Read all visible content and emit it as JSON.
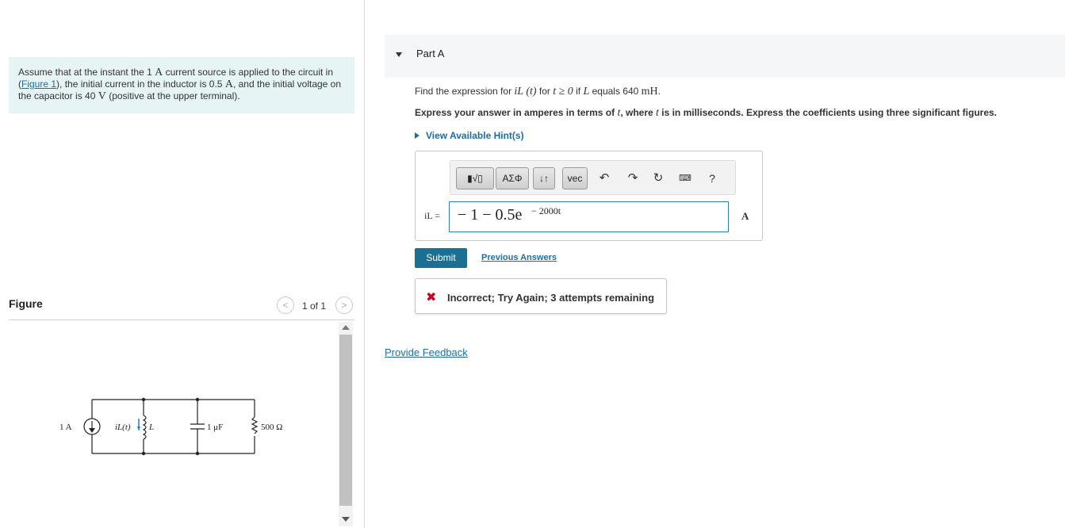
{
  "problem": {
    "text_before_math": "Assume that at the instant the 1 ",
    "current_unit": "A",
    "text_after_unit": " current source is applied to the circuit in ",
    "figure_link": "Figure 1",
    "text_mid": "), the initial current in the inductor is 0.5 ",
    "current_unit_2": "A",
    "text_mid2": ", and the initial voltage on the capacitor is 40 ",
    "voltage_unit": "V",
    "text_end": " (positive at the upper terminal)."
  },
  "figure_panel": {
    "title": "Figure",
    "count": "1 of 1",
    "prev_icon": "chevron-left-icon",
    "next_icon": "chevron-right-icon"
  },
  "circuit": {
    "source_label": "1 A",
    "inductor_current_label": "iL(t)",
    "inductor_label": "L",
    "capacitor_label": "1 μF",
    "resistor_label": "500 Ω"
  },
  "part": {
    "title": "Part A"
  },
  "question": {
    "prefix": "Find the expression for ",
    "var": "iL (t)",
    "mid": " for ",
    "condition": "t ≥ 0",
    "mid2": " if ",
    "L_var": "L",
    "mid3": " equals 640 ",
    "unit": "mH",
    "suffix": "."
  },
  "instruction": {
    "a": "Express your answer in amperes in terms of ",
    "t1": "t",
    "b": ", where ",
    "t2": "t",
    "c": " is in milliseconds. Express the coefficients using three significant figures."
  },
  "hints_link": "View Available Hint(s)",
  "toolbar": {
    "template_btn": "▮√▯",
    "greek_btn": "ΑΣΦ",
    "arrows_btn": "↓↑",
    "vec_btn": "vec",
    "undo_icon": "undo-icon",
    "redo_icon": "redo-icon",
    "reset_icon": "reset-icon",
    "keyboard_icon": "keyboard-icon",
    "help_label": "?"
  },
  "answer": {
    "lhs": "iL =",
    "expression": "− 1 − 0.5e",
    "exponent": "− 2000t",
    "unit": "A"
  },
  "submit_label": "Submit",
  "previous_answers_label": "Previous Answers",
  "feedback": {
    "icon": "✖",
    "text": "Incorrect; Try Again; 3 attempts remaining"
  },
  "provide_feedback_label": "Provide Feedback"
}
